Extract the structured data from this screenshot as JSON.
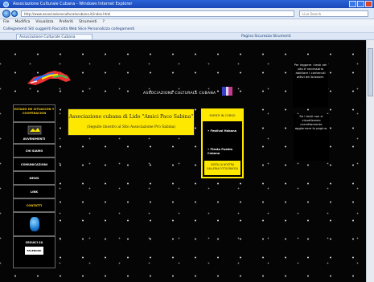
{
  "browser": {
    "title": "Associazione Culturale Cubana - Windows Internet Explorer",
    "url": "http://www.associazioneculturalecubana.it/index.html",
    "search_placeholder": "Live Search",
    "menu": [
      "File",
      "Modifica",
      "Visualizza",
      "Preferiti",
      "Strumenti",
      "?"
    ],
    "links_bar": "Collegamenti    Siti suggeriti    Raccolta Web Slice    Personalizza collegamenti",
    "tab_label": "Associazione Culturale Cubana",
    "toolbar_right": "Pagina  Sicurezza  Strumenti"
  },
  "page": {
    "headline": "ASSOCIAZIONE CULTURALE CUBANA",
    "sidebar": {
      "yellow_block": "ESTADO DE SITUACION Y COOPERACION",
      "icon_block_label": "AVVENIMENTI",
      "buttons": [
        "CHI SIAMO",
        "COMUNICAZIONI",
        "NEWS",
        "LINK",
        "CONTATTI"
      ],
      "bottom": {
        "line": "SEGUICI SU",
        "inner": "FACEBOOK"
      }
    },
    "main_box": {
      "title": "Associazione cubana di Lido \"Amici Paco Sabina\"",
      "subtitle": "(Seguite ilnostro al Sito Associazione Pro Sabina)"
    },
    "right_box": {
      "header": "EVENTI IN CORSO",
      "items": [
        "• Festival Habana",
        "• Fiesta Pueblo Cubano"
      ],
      "footer": "VISITA LA NOSTRA GALLERIA FOTOGRAFICA"
    },
    "notes": [
      "Per leggere i testi del sito è necessario abilitare i contenuti attivi del browser.",
      "Se i testi non si visualizzano correttamente aggiornare la pagina."
    ]
  },
  "colors": {
    "accent_yellow": "#ffe800",
    "sidebar_yellow": "#f1c81c",
    "page_background": "#050505",
    "chrome_blue": "#1a48b8"
  }
}
